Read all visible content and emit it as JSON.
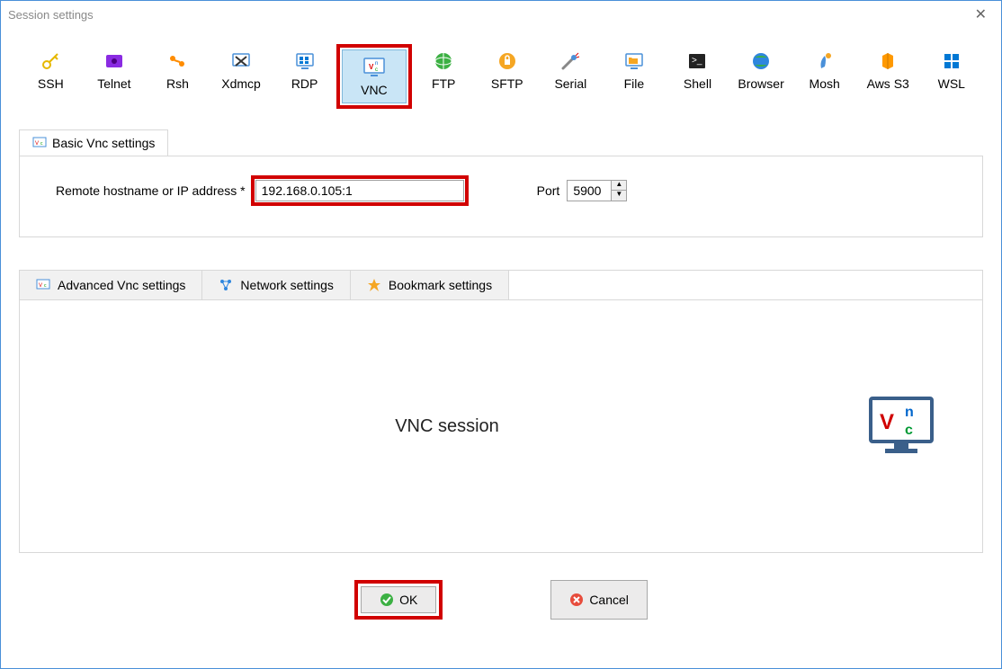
{
  "window": {
    "title": "Session settings"
  },
  "protocols": [
    {
      "label": "SSH"
    },
    {
      "label": "Telnet"
    },
    {
      "label": "Rsh"
    },
    {
      "label": "Xdmcp"
    },
    {
      "label": "RDP"
    },
    {
      "label": "VNC"
    },
    {
      "label": "FTP"
    },
    {
      "label": "SFTP"
    },
    {
      "label": "Serial"
    },
    {
      "label": "File"
    },
    {
      "label": "Shell"
    },
    {
      "label": "Browser"
    },
    {
      "label": "Mosh"
    },
    {
      "label": "Aws S3"
    },
    {
      "label": "WSL"
    }
  ],
  "basic_tab": {
    "label": "Basic Vnc settings",
    "host_label": "Remote hostname or IP address *",
    "host_value": "192.168.0.105:1",
    "port_label": "Port",
    "port_value": "5900"
  },
  "sub_tabs": [
    {
      "label": "Advanced Vnc settings"
    },
    {
      "label": "Network settings"
    },
    {
      "label": "Bookmark settings"
    }
  ],
  "session_panel": {
    "title": "VNC session"
  },
  "buttons": {
    "ok": "OK",
    "cancel": "Cancel"
  }
}
